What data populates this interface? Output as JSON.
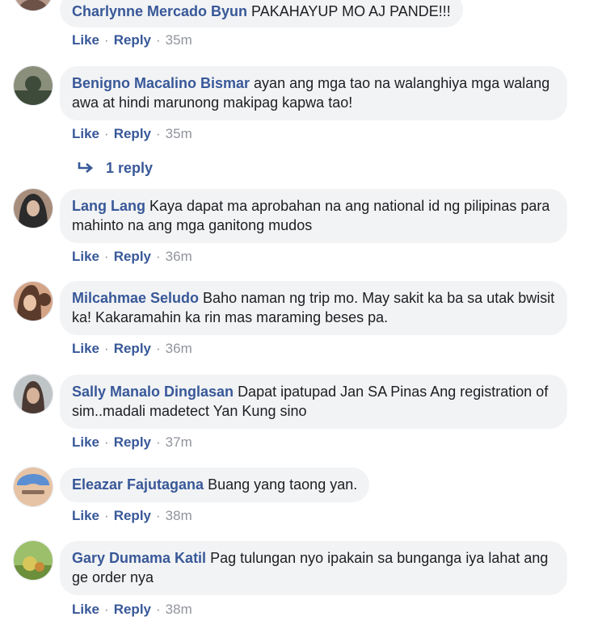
{
  "actions": {
    "like": "Like",
    "reply": "Reply",
    "separator": "·"
  },
  "reply_link": {
    "label": "1 reply"
  },
  "comments": [
    {
      "author": "Charlynne Mercado Byun",
      "text": "PAKAHAYUP MO AJ PANDE!!!",
      "time": "35m",
      "avatar_colors": [
        "#b89a8c",
        "#6d5247"
      ]
    },
    {
      "author": "Benigno Macalino Bismar",
      "text": "ayan ang mga tao na walanghiya mga walang awa at hindi marunong makipag kapwa tao!",
      "time": "35m",
      "avatar_colors": [
        "#3e4b3b",
        "#8a8f7c"
      ]
    },
    {
      "author": "Lang Lang",
      "text": "Kaya dapat ma aprobahan na ang national id ng pilipinas para mahinto na ang mga ganitong mudos",
      "time": "36m",
      "avatar_colors": [
        "#2b2b2b",
        "#a78d7c"
      ]
    },
    {
      "author": "Milcahmae Seludo",
      "text": "Baho naman ng trip mo. May sakit ka ba sa utak bwisit ka! Kakaramahin ka rin mas maraming beses pa.",
      "time": "36m",
      "avatar_colors": [
        "#5a3b2c",
        "#d4a487"
      ]
    },
    {
      "author": "Sally Manalo Dinglasan",
      "text": "Dapat ipatupad Jan SA Pinas Ang registration of sim..madali madetect Yan Kung sino",
      "time": "37m",
      "avatar_colors": [
        "#bfc4c7",
        "#4a3a33"
      ]
    },
    {
      "author": "Eleazar Fajutagana",
      "text": "Buang yang taong yan.",
      "time": "38m",
      "avatar_colors": [
        "#5b8fd1",
        "#e6c3a5"
      ]
    },
    {
      "author": "Gary Dumama Katil",
      "text": "Pag tulungan nyo ipakain sa bunganga iya lahat ang ge order nya",
      "time": "38m",
      "avatar_colors": [
        "#d9c65a",
        "#6b8f3a"
      ]
    }
  ]
}
